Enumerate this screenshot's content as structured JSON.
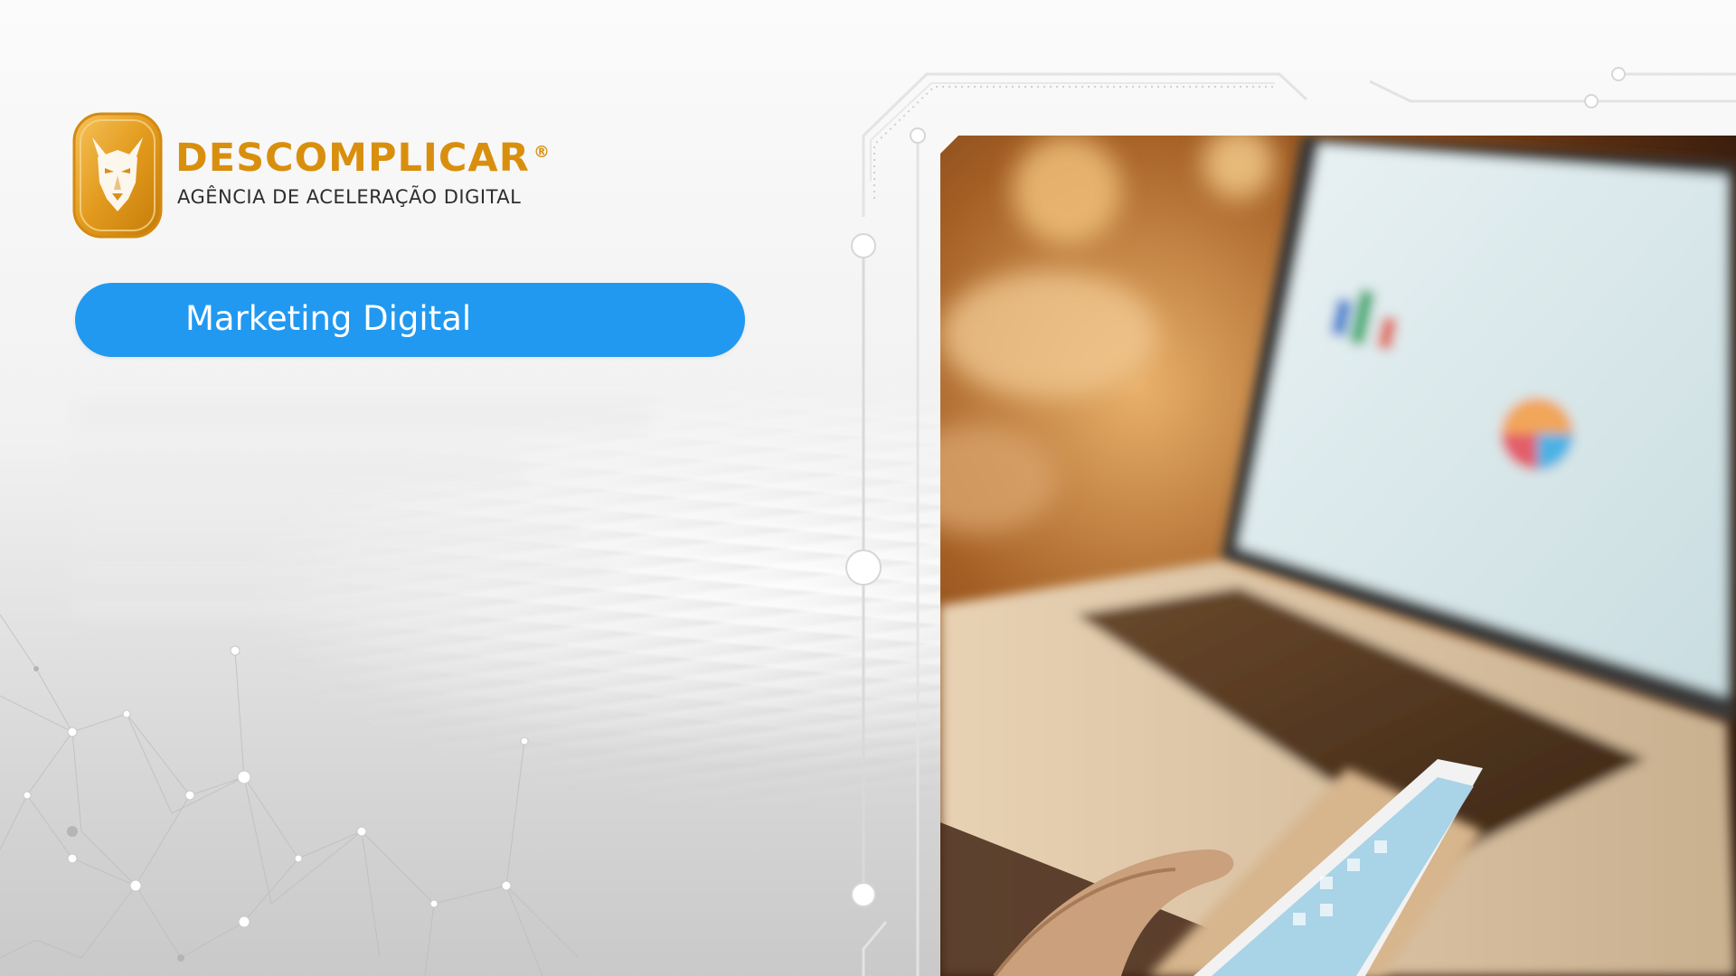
{
  "brand": {
    "name": "DESCOMPLICAR",
    "registered_mark": "®",
    "tagline": "AGÊNCIA DE ACELERAÇÃO DIGITAL",
    "logo_icon": "wolf-badge-icon",
    "color": "#d98f0e"
  },
  "category_pill": {
    "label": "Marketing Digital",
    "color": "#2199f1"
  },
  "photo": {
    "subject_icon": "laptop-and-phone-photo"
  }
}
